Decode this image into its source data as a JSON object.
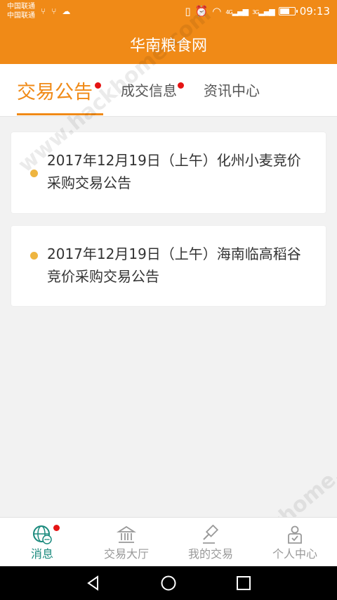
{
  "status_bar": {
    "carrier_1": "中国联通",
    "carrier_2": "中国联通",
    "time": "09:13",
    "net_1": "4G",
    "net_2": "3G",
    "battery_level": 0.7
  },
  "app_bar": {
    "title": "华南粮食网"
  },
  "tabs": [
    {
      "label": "交易公告",
      "active": true,
      "has_dot": true
    },
    {
      "label": "成交信息",
      "active": false,
      "has_dot": true
    },
    {
      "label": "资讯中心",
      "active": false,
      "has_dot": false
    }
  ],
  "announcements": [
    {
      "text": "2017年12月19日（上午）化州小麦竞价采购交易公告"
    },
    {
      "text": "2017年12月19日（上午）海南临高稻谷竞价采购交易公告"
    }
  ],
  "bottom_nav": [
    {
      "label": "消息",
      "icon": "message-globe-icon",
      "active": true,
      "has_dot": true
    },
    {
      "label": "交易大厅",
      "icon": "bank-hall-icon",
      "active": false
    },
    {
      "label": "我的交易",
      "icon": "gavel-icon",
      "active": false
    },
    {
      "label": "个人中心",
      "icon": "user-icon",
      "active": false
    }
  ],
  "colors": {
    "brand_orange": "#f08a17",
    "bullet_yellow": "#eeb540",
    "nav_active_teal": "#1a8a7d",
    "badge_red": "#e51414"
  }
}
